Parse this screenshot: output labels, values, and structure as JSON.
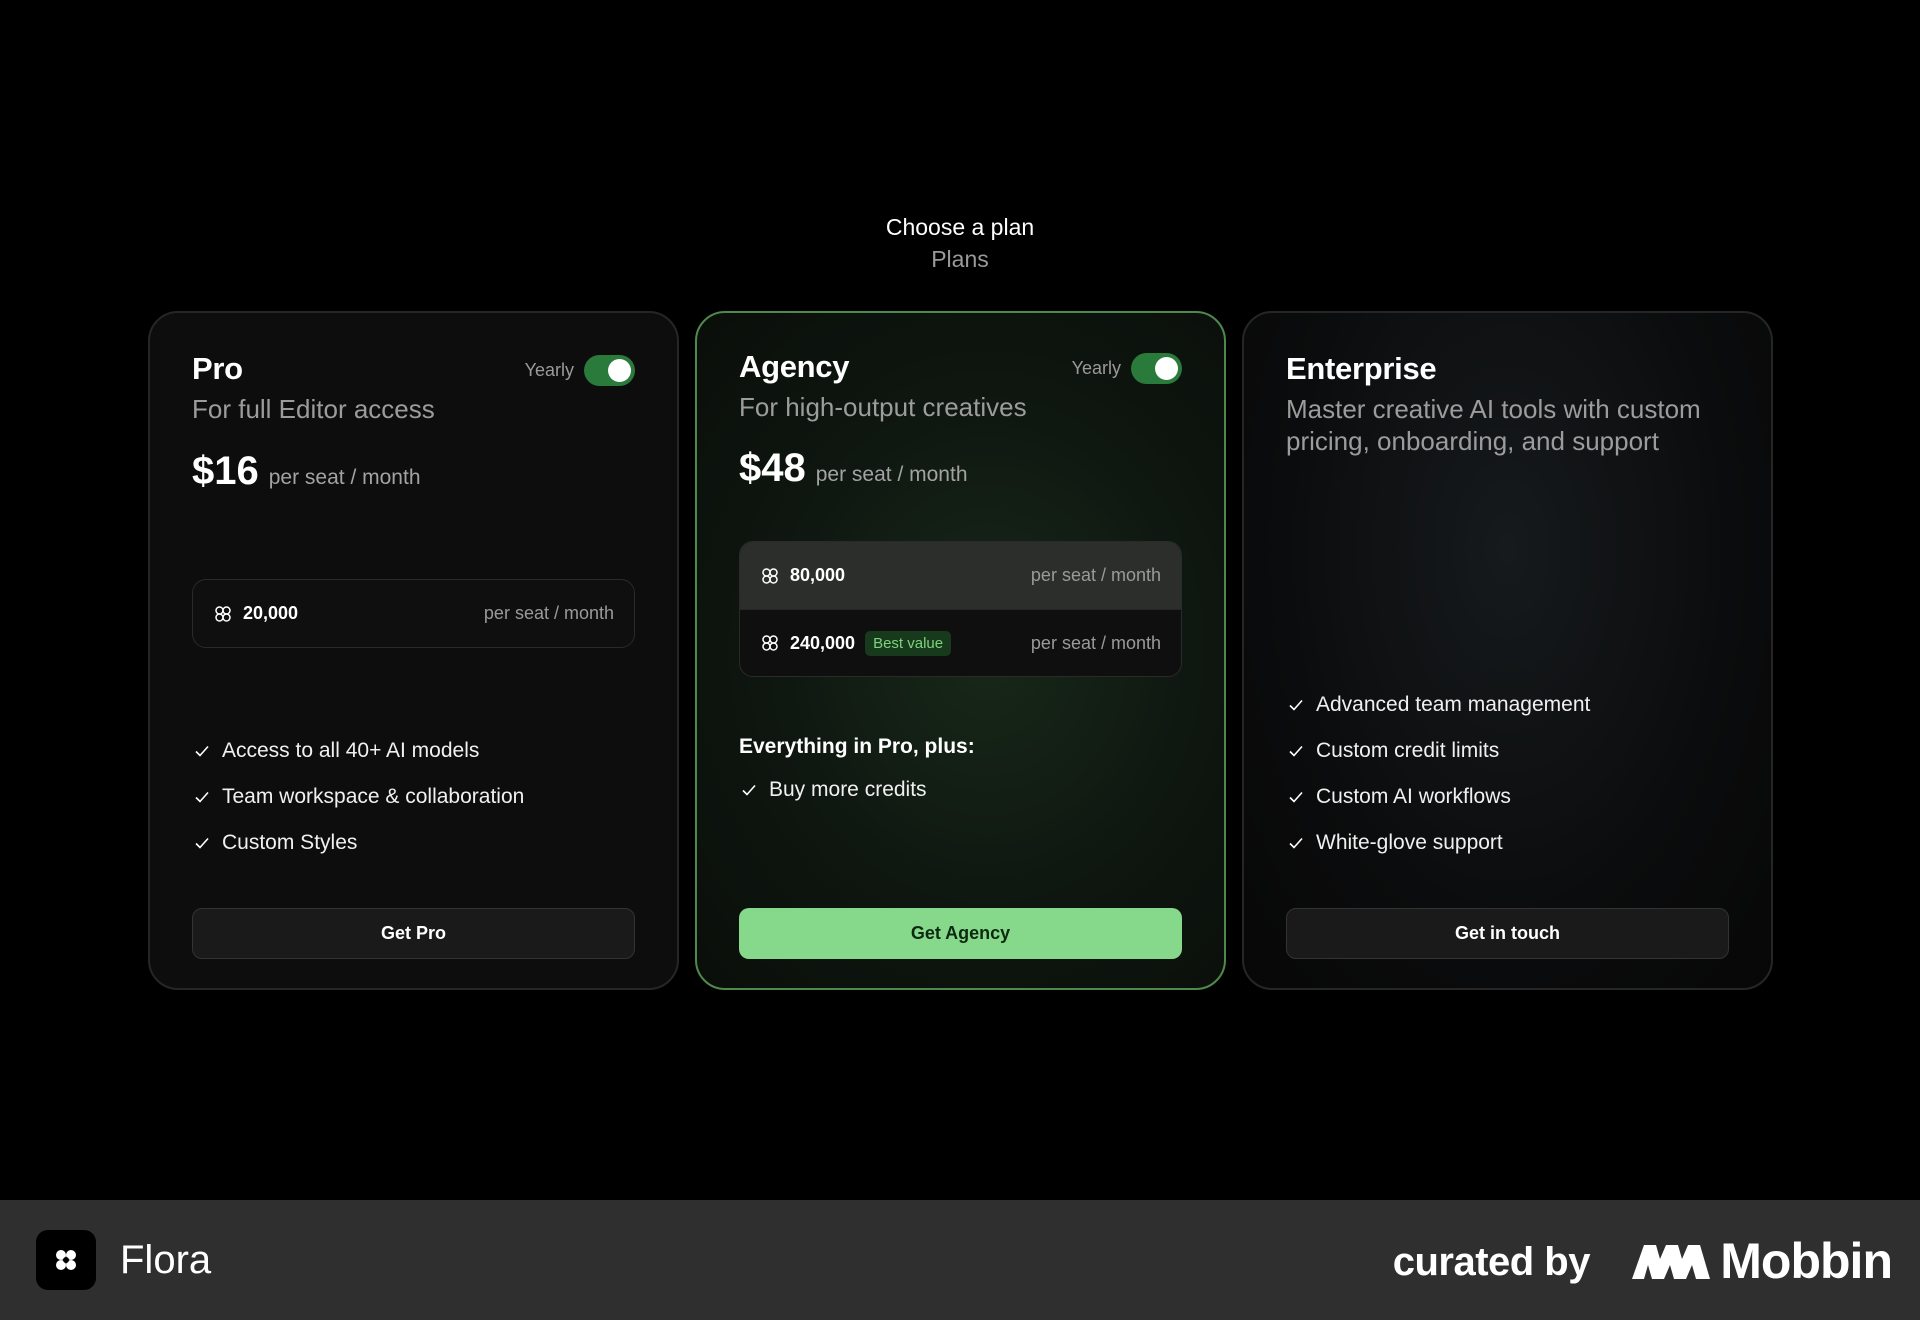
{
  "header": {
    "title": "Choose a plan",
    "subtitle": "Plans"
  },
  "plans": [
    {
      "name": "Pro",
      "description": "For full Editor access",
      "billing_label": "Yearly",
      "billing_toggle_on": true,
      "price": "$16",
      "price_unit": "per seat / month",
      "credits": [
        {
          "amount": "20,000",
          "unit": "per seat / month"
        }
      ],
      "features": [
        "Access to all 40+ AI models",
        "Team workspace & collaboration",
        "Custom Styles"
      ],
      "cta": "Get Pro"
    },
    {
      "name": "Agency",
      "description": "For high-output creatives",
      "billing_label": "Yearly",
      "billing_toggle_on": true,
      "price": "$48",
      "price_unit": "per seat / month",
      "credits": [
        {
          "amount": "80,000",
          "unit": "per seat / month"
        },
        {
          "amount": "240,000",
          "badge": "Best value",
          "unit": "per seat / month"
        }
      ],
      "features_heading": "Everything in Pro, plus:",
      "features": [
        "Buy more credits"
      ],
      "cta": "Get Agency"
    },
    {
      "name": "Enterprise",
      "description": "Master creative AI tools with custom pricing, onboarding, and support",
      "features": [
        "Advanced team management",
        "Custom credit limits",
        "Custom AI workflows",
        "White-glove support"
      ],
      "cta": "Get in touch"
    }
  ],
  "footer": {
    "app_name": "Flora",
    "curated_label": "curated by",
    "brand": "Mobbin"
  },
  "colors": {
    "accent_green": "#86d98a",
    "toggle_green": "#2a7a3b",
    "agency_border": "#4f8a4c"
  }
}
